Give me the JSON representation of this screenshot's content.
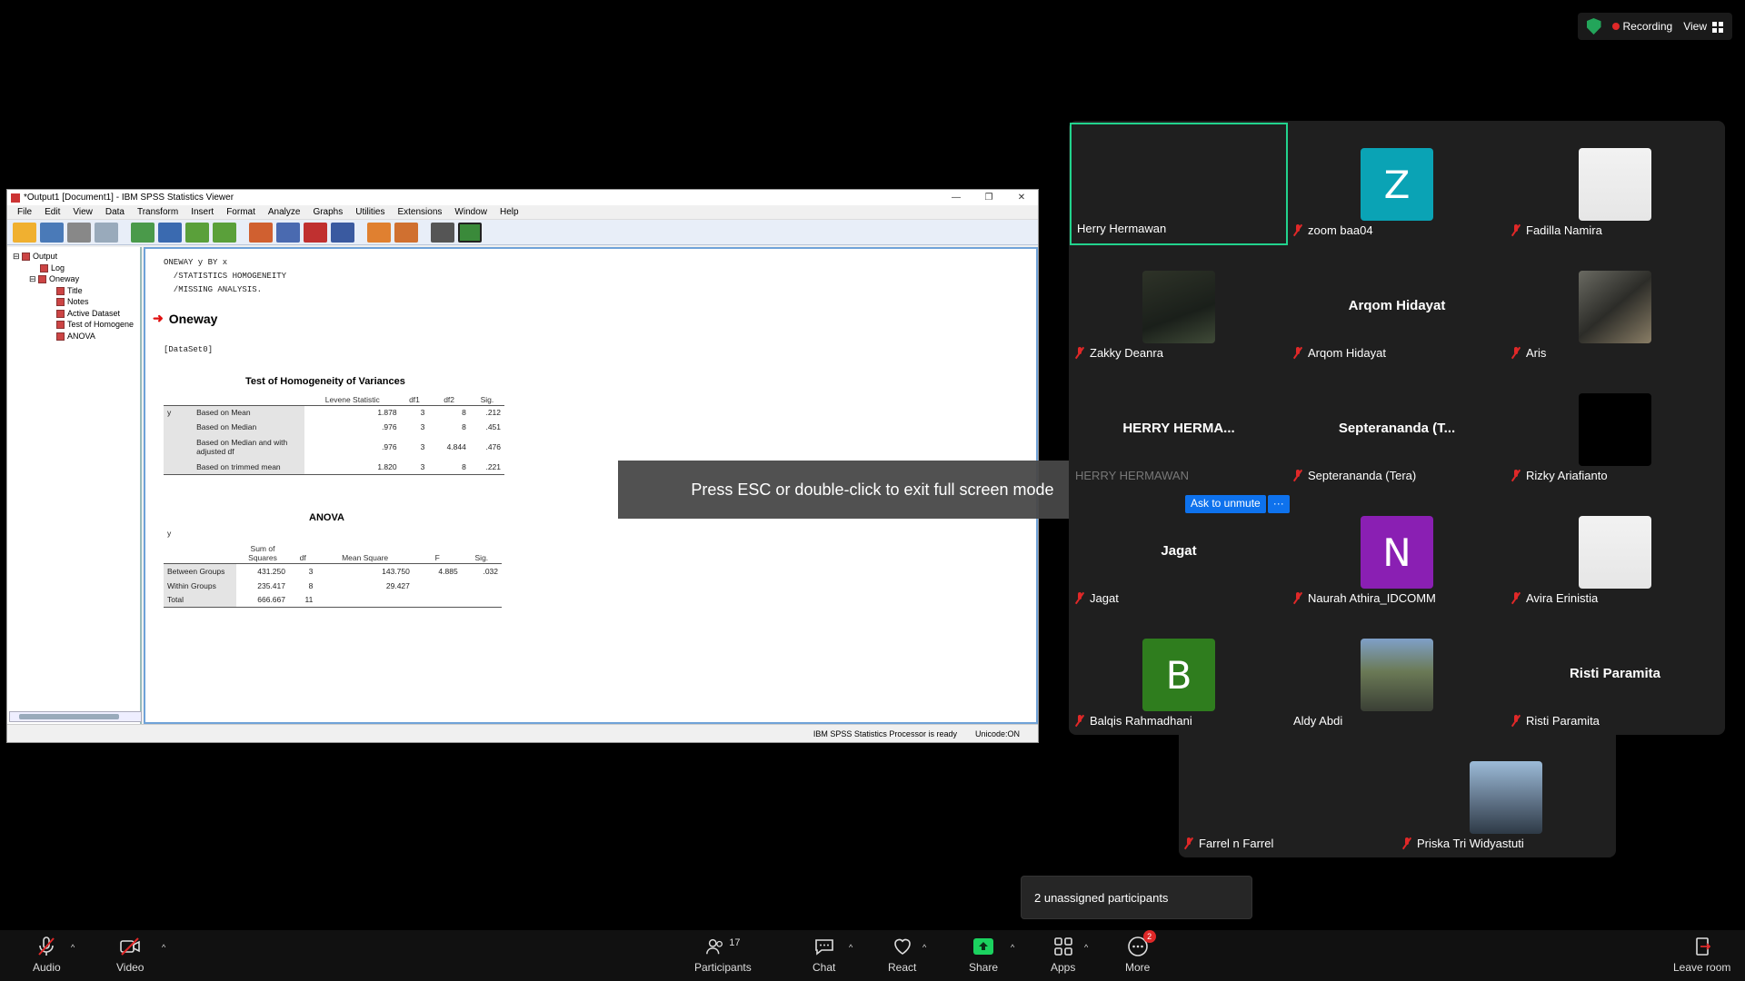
{
  "topbar": {
    "recording_label": "Recording",
    "view_label": "View"
  },
  "spss": {
    "title": "*Output1 [Document1] - IBM SPSS Statistics Viewer",
    "menu": [
      "File",
      "Edit",
      "View",
      "Data",
      "Transform",
      "Insert",
      "Format",
      "Analyze",
      "Graphs",
      "Utilities",
      "Extensions",
      "Window",
      "Help"
    ],
    "tree": [
      "Output",
      "Log",
      "Oneway",
      "Title",
      "Notes",
      "Active Dataset",
      "Test of Homogene",
      "ANOVA"
    ],
    "syntax": [
      "ONEWAY y BY x",
      "  /STATISTICS HOMOGENEITY",
      "  /MISSING ANALYSIS."
    ],
    "heading": "Oneway",
    "dataset": "[DataSet0]",
    "homog": {
      "title": "Test of Homogeneity of Variances",
      "headers": [
        "Levene Statistic",
        "df1",
        "df2",
        "Sig."
      ],
      "var": "y",
      "rows": [
        [
          "Based on Mean",
          "1.878",
          "3",
          "8",
          ".212"
        ],
        [
          "Based on Median",
          ".976",
          "3",
          "8",
          ".451"
        ],
        [
          "Based on Median and with adjusted df",
          ".976",
          "3",
          "4.844",
          ".476"
        ],
        [
          "Based on trimmed mean",
          "1.820",
          "3",
          "8",
          ".221"
        ]
      ]
    },
    "anova": {
      "title": "ANOVA",
      "var": "y",
      "headers": [
        "Sum of Squares",
        "df",
        "Mean Square",
        "F",
        "Sig."
      ],
      "rows": [
        [
          "Between Groups",
          "431.250",
          "3",
          "143.750",
          "4.885",
          ".032"
        ],
        [
          "Within Groups",
          "235.417",
          "8",
          "29.427",
          "",
          ""
        ],
        [
          "Total",
          "666.667",
          "11",
          "",
          "",
          ""
        ]
      ]
    },
    "status_ready": "IBM SPSS Statistics Processor is ready",
    "status_unicode": "Unicode:ON"
  },
  "toast": "Press ESC or double-click to exit full screen mode",
  "participants": [
    {
      "name": "Herry Hermawan",
      "style": "blank",
      "muted": false,
      "active": true
    },
    {
      "name": "zoom baa04",
      "style": "letter",
      "letter": "Z",
      "color": "#0aa3b5",
      "muted": true
    },
    {
      "name": "Fadilla Namira",
      "style": "photo",
      "photo": "hijab",
      "muted": true
    },
    {
      "name": "Zakky Deanra",
      "style": "photo",
      "photo": "dark",
      "muted": true
    },
    {
      "name": "Arqom Hidayat",
      "style": "big",
      "big": "Arqom Hidayat",
      "muted": true
    },
    {
      "name": "Aris",
      "style": "photo",
      "photo": "crowd",
      "muted": true
    },
    {
      "name": "HERRY HERMAWAN",
      "style": "big",
      "big": "HERRY HERMA...",
      "muted": false
    },
    {
      "name": "Septerananda (Tera)",
      "style": "big",
      "big": "Septerananda (T...",
      "muted": true
    },
    {
      "name": "Rizky Ariafianto",
      "style": "black",
      "muted": true
    },
    {
      "name": "Jagat",
      "style": "big",
      "big": "Jagat",
      "muted": true
    },
    {
      "name": "Naurah Athira_IDCOMM",
      "style": "letter",
      "letter": "N",
      "color": "#8a1fb3",
      "muted": true
    },
    {
      "name": "Avira Erinistia",
      "style": "photo",
      "photo": "hijab",
      "muted": true
    },
    {
      "name": "Balqis Rahmadhani",
      "style": "letter",
      "letter": "B",
      "color": "#2f7d1e",
      "muted": true
    },
    {
      "name": "Aldy Abdi",
      "style": "photo",
      "photo": "street",
      "muted": false
    },
    {
      "name": "Risti Paramita",
      "style": "big",
      "big": "Risti Paramita",
      "muted": true
    },
    {
      "name": "Farrel n Farrel",
      "style": "blank",
      "muted": true
    },
    {
      "name": "Priska Tri Widyastuti",
      "style": "photo",
      "photo": "tower",
      "muted": true
    }
  ],
  "unmute": {
    "label": "Ask to unmute",
    "more": "···"
  },
  "unassigned": "2 unassigned participants",
  "toolbar": {
    "audio": "Audio",
    "video": "Video",
    "participants": "Participants",
    "participants_count": "17",
    "chat": "Chat",
    "react": "React",
    "share": "Share",
    "apps": "Apps",
    "more": "More",
    "more_badge": "2",
    "leave": "Leave room"
  }
}
